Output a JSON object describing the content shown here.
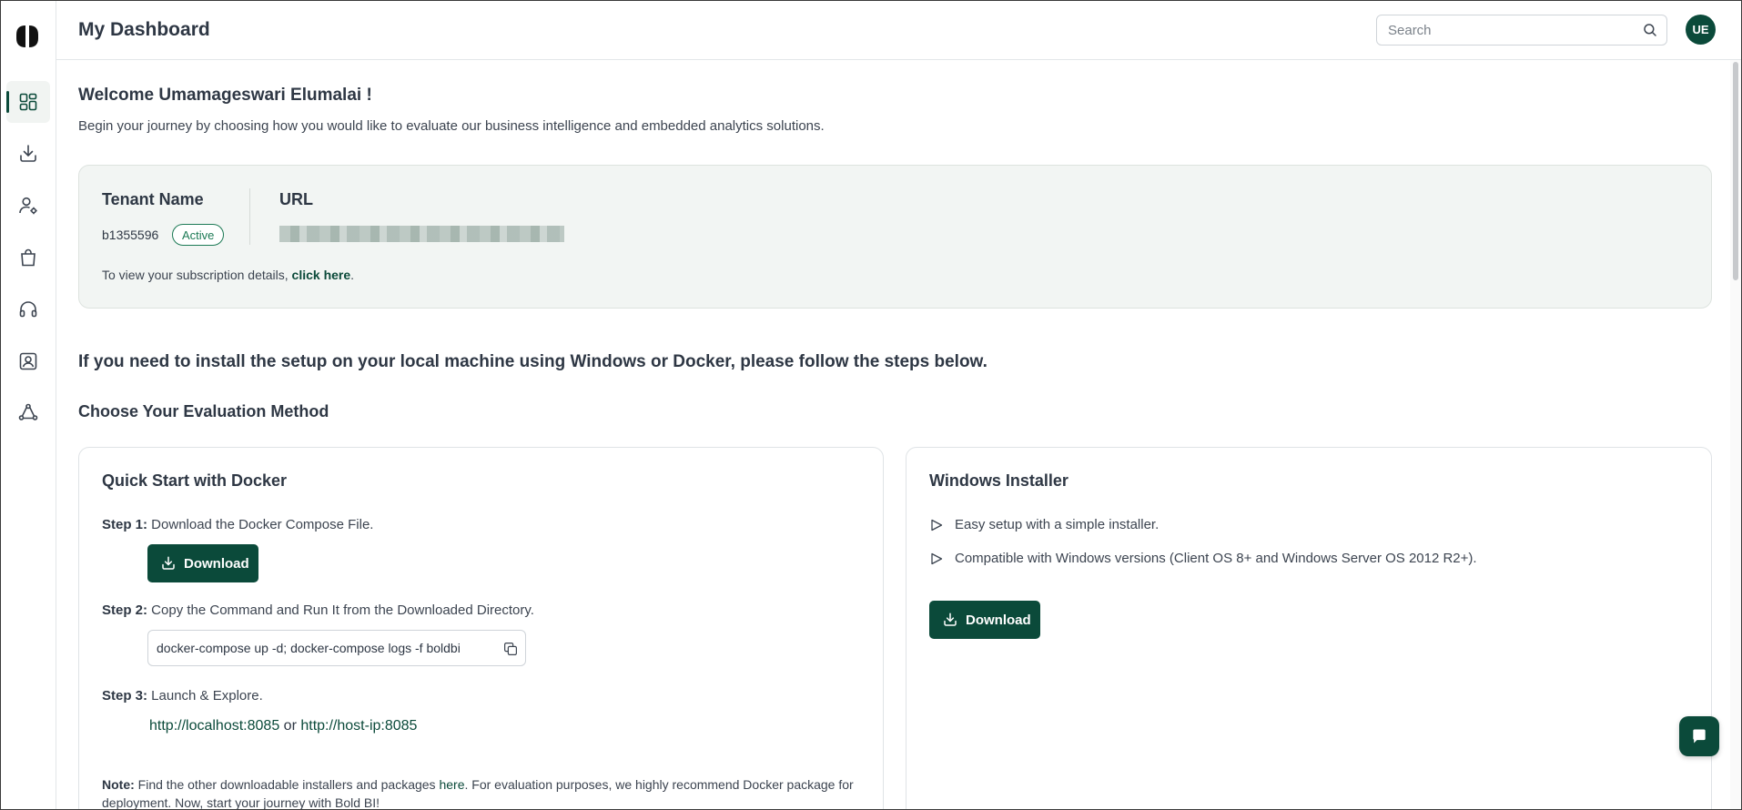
{
  "header": {
    "title": "My Dashboard",
    "search_placeholder": "Search",
    "avatar_initials": "UE"
  },
  "sidebar": {
    "items": [
      {
        "name": "dashboard",
        "icon": "grid-icon",
        "active": true
      },
      {
        "name": "downloads",
        "icon": "download-icon",
        "active": false
      },
      {
        "name": "user-settings",
        "icon": "user-gear-icon",
        "active": false
      },
      {
        "name": "store",
        "icon": "bag-icon",
        "active": false
      },
      {
        "name": "support",
        "icon": "headset-icon",
        "active": false
      },
      {
        "name": "contacts",
        "icon": "contact-card-icon",
        "active": false
      },
      {
        "name": "community",
        "icon": "community-icon",
        "active": false
      }
    ]
  },
  "welcome": {
    "heading": "Welcome Umamageswari Elumalai !",
    "intro": "Begin your journey by choosing how you would like to evaluate our business intelligence and embedded analytics solutions."
  },
  "tenant": {
    "name_label": "Tenant Name",
    "id": "b1355596",
    "status": "Active",
    "url_label": "URL",
    "subscription_text": "To view your subscription details, ",
    "subscription_link": "click here",
    "subscription_suffix": "."
  },
  "setup": {
    "heading": "If you need to install the setup on your local machine using Windows or Docker, please follow the steps below.",
    "eval_heading": "Choose Your Evaluation Method"
  },
  "docker": {
    "title": "Quick Start with Docker",
    "step1_label": "Step 1:",
    "step1_text": " Download the Docker Compose File.",
    "download_label": "Download",
    "step2_label": "Step 2:",
    "step2_text": " Copy the Command and Run It from the Downloaded Directory.",
    "command": "docker-compose up -d; docker-compose logs -f boldbi",
    "step3_label": "Step 3:",
    "step3_text": " Launch & Explore.",
    "link1": "http://localhost:8085",
    "link_or": " or ",
    "link2": "http://host-ip:8085",
    "note_label": "Note:",
    "note_text_1": " Find the other downloadable installers and packages ",
    "note_link": "here",
    "note_text_2": ". For evaluation purposes, we highly recommend Docker package for deployment. Now, start your journey with Bold BI!"
  },
  "windows": {
    "title": "Windows Installer",
    "feature1": "Easy setup with a simple installer.",
    "feature2": "Compatible with Windows versions (Client OS 8+ and Windows Server OS 2012 R2+).",
    "download_label": "Download"
  },
  "colors": {
    "accent": "#0b4a3a",
    "active_badge": "#1d7a55",
    "card_bg": "#f2f5f3"
  }
}
